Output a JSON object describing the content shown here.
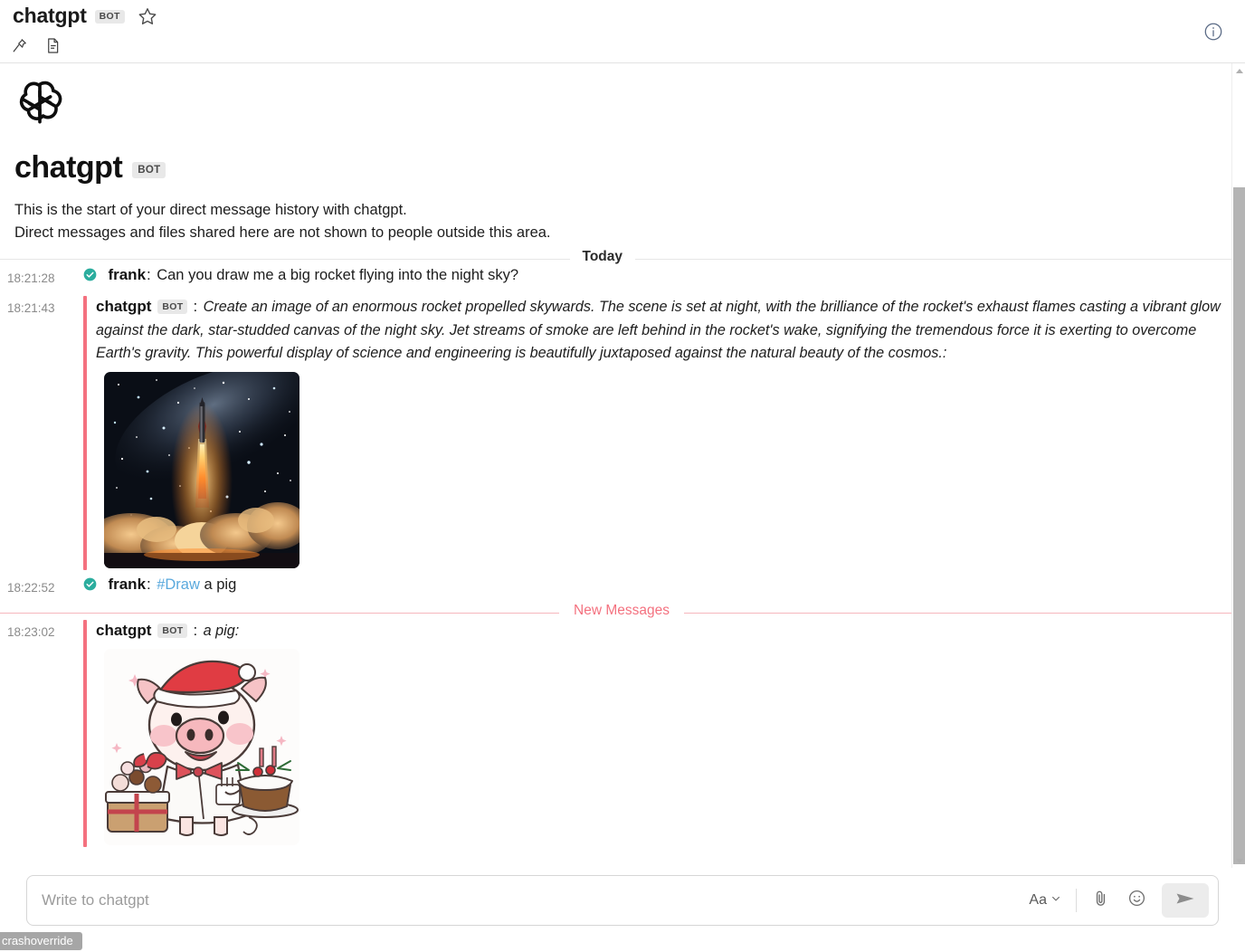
{
  "header": {
    "title": "chatgpt",
    "bot_badge": "BOT",
    "icons": {
      "star": "star-icon",
      "pin": "pin-icon",
      "file": "file-icon",
      "info": "info-icon"
    }
  },
  "intro": {
    "logo": "openai-logo",
    "name": "chatgpt",
    "bot_badge": "BOT",
    "line1": "This is the start of your direct message history with chatgpt.",
    "line2": "Direct messages and files shared here are not shown to people outside this area."
  },
  "dividers": {
    "today": "Today",
    "new_messages": "New Messages"
  },
  "messages": [
    {
      "timestamp": "18:21:28",
      "author": "frank",
      "verified": true,
      "colon": ":",
      "text": "Can you draw me a big rocket flying into the night sky?"
    },
    {
      "timestamp": "18:21:43",
      "author": "chatgpt",
      "bot_badge": "BOT",
      "colon": ":",
      "text": "Create an image of an enormous rocket propelled skywards. The scene is set at night, with the brilliance of the rocket's exhaust flames casting a vibrant glow against the dark, star-studded canvas of the night sky. Jet streams of smoke are left behind in the rocket's wake, signifying the tremendous force it is exerting to overcome Earth's gravity. This powerful display of science and engineering is beautifully juxtaposed against the natural beauty of the cosmos.:",
      "attachment": "rocket-night-sky-image"
    },
    {
      "timestamp": "18:22:52",
      "author": "frank",
      "verified": true,
      "colon": ":",
      "link_text": "#Draw",
      "text": " a pig"
    },
    {
      "timestamp": "18:23:02",
      "author": "chatgpt",
      "bot_badge": "BOT",
      "colon": ":",
      "text": "a pig:",
      "attachment": "pig-santa-cake-image"
    }
  ],
  "composer": {
    "placeholder": "Write to chatgpt",
    "value": "",
    "format_label": "Aa",
    "icons": {
      "format": "format-text-icon",
      "chevron": "chevron-down-icon",
      "attach": "paperclip-icon",
      "emoji": "emoji-icon",
      "send": "send-icon"
    }
  },
  "statusbar": {
    "text": "crashoverride"
  },
  "colors": {
    "accent_red": "#f4717f",
    "link_blue": "#5aa9dd",
    "verified_teal": "#2bad9e",
    "badge_gray": "#e8e8e8",
    "status_gray": "#a6a6a6"
  }
}
